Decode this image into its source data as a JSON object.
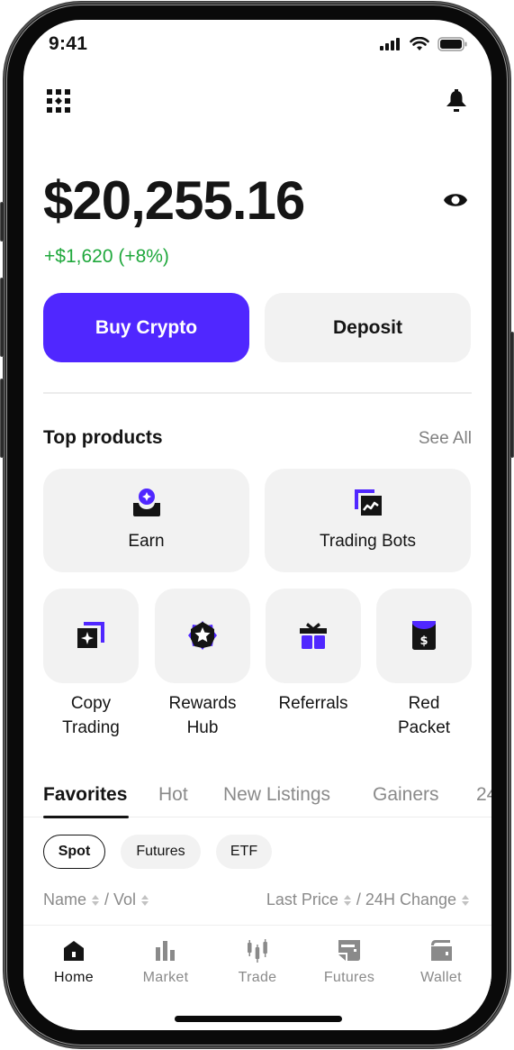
{
  "status_bar": {
    "time": "9:41"
  },
  "colors": {
    "accent": "#5027ff",
    "positive": "#1fa83c",
    "card_bg": "#f2f2f2",
    "muted_text": "#8a8a8a"
  },
  "header": {
    "left_icon": "grid-apps-icon",
    "right_icon": "bell-icon"
  },
  "balance": {
    "amount": "$20,255.16",
    "change": "+$1,620 (+8%)",
    "visibility_icon": "eye-icon"
  },
  "actions": {
    "buy_label": "Buy Crypto",
    "deposit_label": "Deposit"
  },
  "top_products": {
    "title": "Top products",
    "see_all": "See All",
    "large": [
      {
        "label": "Earn",
        "icon": "earn-icon"
      },
      {
        "label": "Trading Bots",
        "icon": "trading-bots-icon"
      }
    ],
    "small": [
      {
        "line1": "Copy",
        "line2": "Trading",
        "icon": "copy-trading-icon"
      },
      {
        "line1": "Rewards",
        "line2": "Hub",
        "icon": "rewards-badge-icon"
      },
      {
        "line1": "Referrals",
        "line2": "",
        "icon": "gift-icon"
      },
      {
        "line1": "Red",
        "line2": "Packet",
        "icon": "red-packet-icon"
      }
    ]
  },
  "market_tabs": [
    "Favorites",
    "Hot",
    "New Listings",
    "Gainers",
    "24"
  ],
  "active_tab": "Favorites",
  "filter_chips": [
    "Spot",
    "Futures",
    "ETF"
  ],
  "active_chip": "Spot",
  "columns": {
    "name": "Name",
    "vol": "/ Vol",
    "last_price": "Last Price",
    "change": "/ 24H Change"
  },
  "bottom_nav": [
    {
      "label": "Home",
      "icon": "home-icon",
      "active": true
    },
    {
      "label": "Market",
      "icon": "bar-chart-icon",
      "active": false
    },
    {
      "label": "Trade",
      "icon": "candlestick-icon",
      "active": false
    },
    {
      "label": "Futures",
      "icon": "futures-icon",
      "active": false
    },
    {
      "label": "Wallet",
      "icon": "wallet-icon",
      "active": false
    }
  ]
}
